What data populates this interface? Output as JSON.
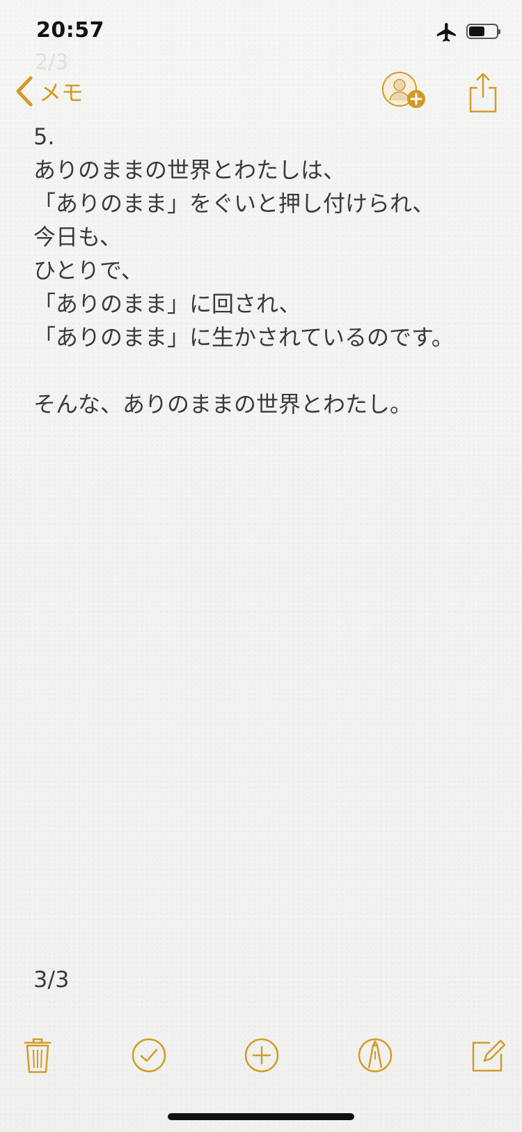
{
  "status_bar": {
    "time": "20:57"
  },
  "ghost_text": "2/3",
  "nav": {
    "back_label": "メモ"
  },
  "note": {
    "lines": [
      "5.",
      "ありのままの世界とわたしは、",
      "「ありのまま」をぐいと押し付けられ、",
      "今日も、",
      "ひとりで、",
      "「ありのまま」に回され、",
      "「ありのまま」に生かされているのです。",
      "",
      "そんな、ありのままの世界とわたし。"
    ],
    "page_count": "3/3"
  },
  "colors": {
    "accent": "#d19b24",
    "text": "#3a3a3a",
    "background": "#f4f4f2"
  },
  "icons": {
    "back": "chevron-left-icon",
    "add_person": "add-person-icon",
    "share": "share-icon",
    "trash": "trash-icon",
    "checklist": "checkmark-circle-icon",
    "add": "plus-circle-icon",
    "markup": "pen-circle-icon",
    "compose": "compose-icon"
  }
}
